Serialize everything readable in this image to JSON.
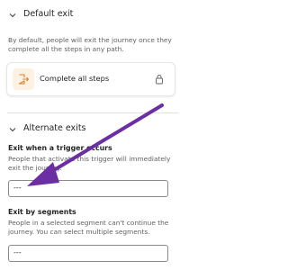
{
  "default_exit": {
    "title": "Default exit",
    "description": "By default, people will exit the journey once they complete all the steps in any path.",
    "step_card": {
      "label": "Complete all steps",
      "icon": "exit-door-icon",
      "lock_icon": "lock-icon"
    }
  },
  "alternate_exits": {
    "title": "Alternate exits",
    "trigger": {
      "label": "Exit when a trigger occurs",
      "description": "People that activate this trigger will immediately exit the journey.",
      "value": "---"
    },
    "segments": {
      "label": "Exit by segments",
      "description": "People in a selected segment can't continue the journey. You can select multiple segments.",
      "value": "---"
    }
  },
  "annotation": {
    "arrow_color": "#6b2fa3"
  },
  "colors": {
    "step_icon": "#d9822b",
    "step_icon_bg": "#fdf1e3"
  }
}
